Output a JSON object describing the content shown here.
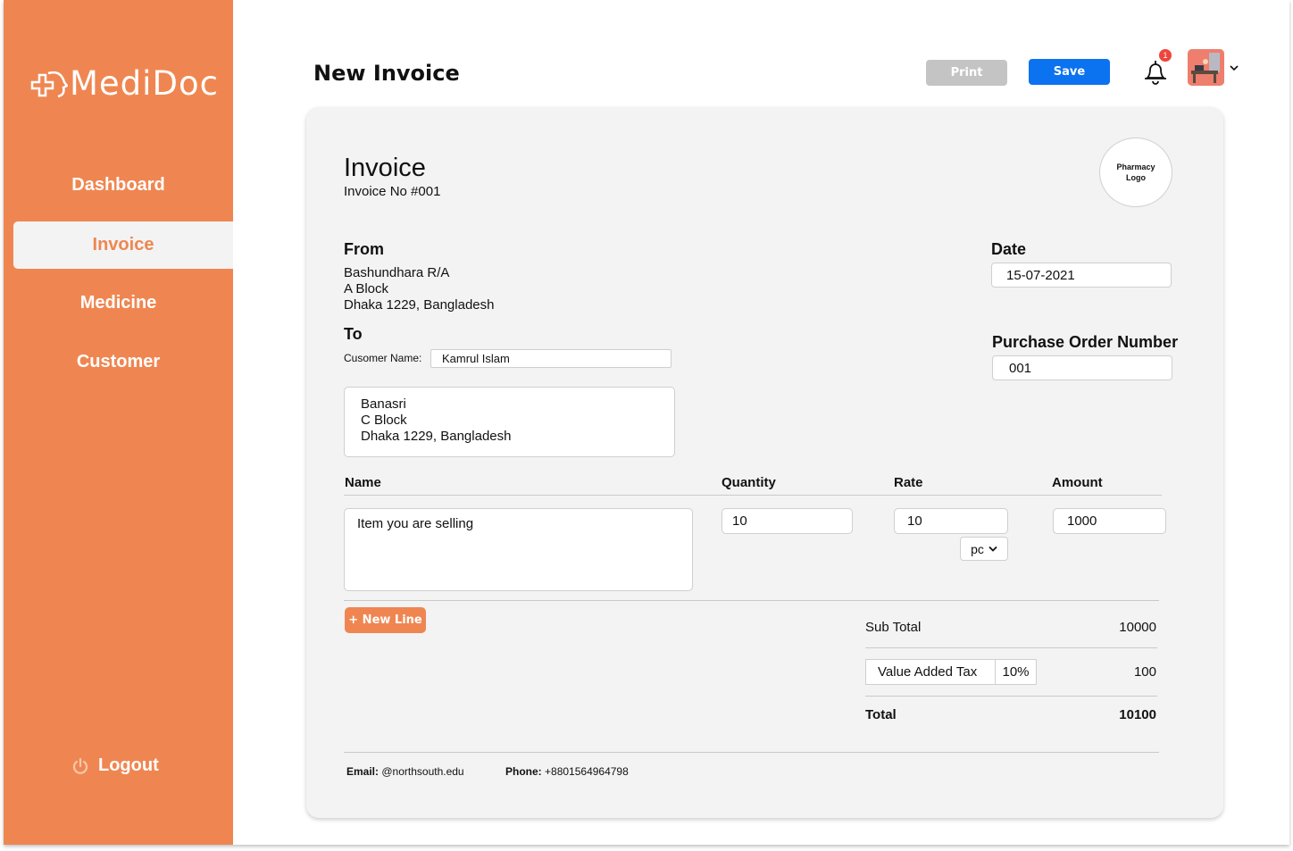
{
  "app": {
    "name": "MediDoc"
  },
  "sidebar": {
    "items": [
      {
        "label": "Dashboard"
      },
      {
        "label": "Invoice",
        "active": true
      },
      {
        "label": "Medicine"
      },
      {
        "label": "Customer"
      }
    ],
    "logout_label": "Logout"
  },
  "header": {
    "title": "New Invoice",
    "print_label": "Print",
    "save_label": "Save",
    "notification_count": "1"
  },
  "invoice": {
    "title": "Invoice",
    "number": "Invoice No #001",
    "logo_placeholder": "Pharmacy Logo",
    "from": {
      "label": "From",
      "line1": "Bashundhara R/A",
      "line2": "A Block",
      "line3": "Dhaka 1229, Bangladesh"
    },
    "to": {
      "label": "To",
      "customer_name_label": "Cusomer Name:",
      "customer_name": "Kamrul Islam",
      "line1": "Banasri",
      "line2": "C Block",
      "line3": "Dhaka 1229, Bangladesh"
    },
    "date": {
      "label": "Date",
      "value": "15-07-2021"
    },
    "po": {
      "label": "Purchase Order Number",
      "value": "001"
    },
    "columns": {
      "name": "Name",
      "quantity": "Quantity",
      "rate": "Rate",
      "amount": "Amount"
    },
    "line_item": {
      "name": "Item you are selling",
      "quantity": "10",
      "rate": "10",
      "unit": "pc",
      "amount": "1000"
    },
    "new_line_label": "+ New Line",
    "totals": {
      "subtotal_label": "Sub Total",
      "subtotal_value": "10000",
      "vat_label": "Value Added Tax",
      "vat_percent": "10%",
      "vat_value": "100",
      "total_label": "Total",
      "total_value": "10100"
    },
    "footer": {
      "email_label": "Email:",
      "email_value": "@northsouth.edu",
      "phone_label": "Phone:",
      "phone_value": "+8801564964798"
    }
  },
  "colors": {
    "brand": "#EF8651",
    "primary": "#0B72F0",
    "disabled": "#C4C4C4",
    "badge": "#F0443C"
  },
  "icons": {
    "logo": "medidoc-logo-icon",
    "bell": "bell-icon",
    "chevron": "chevron-down-icon",
    "power": "power-icon"
  }
}
